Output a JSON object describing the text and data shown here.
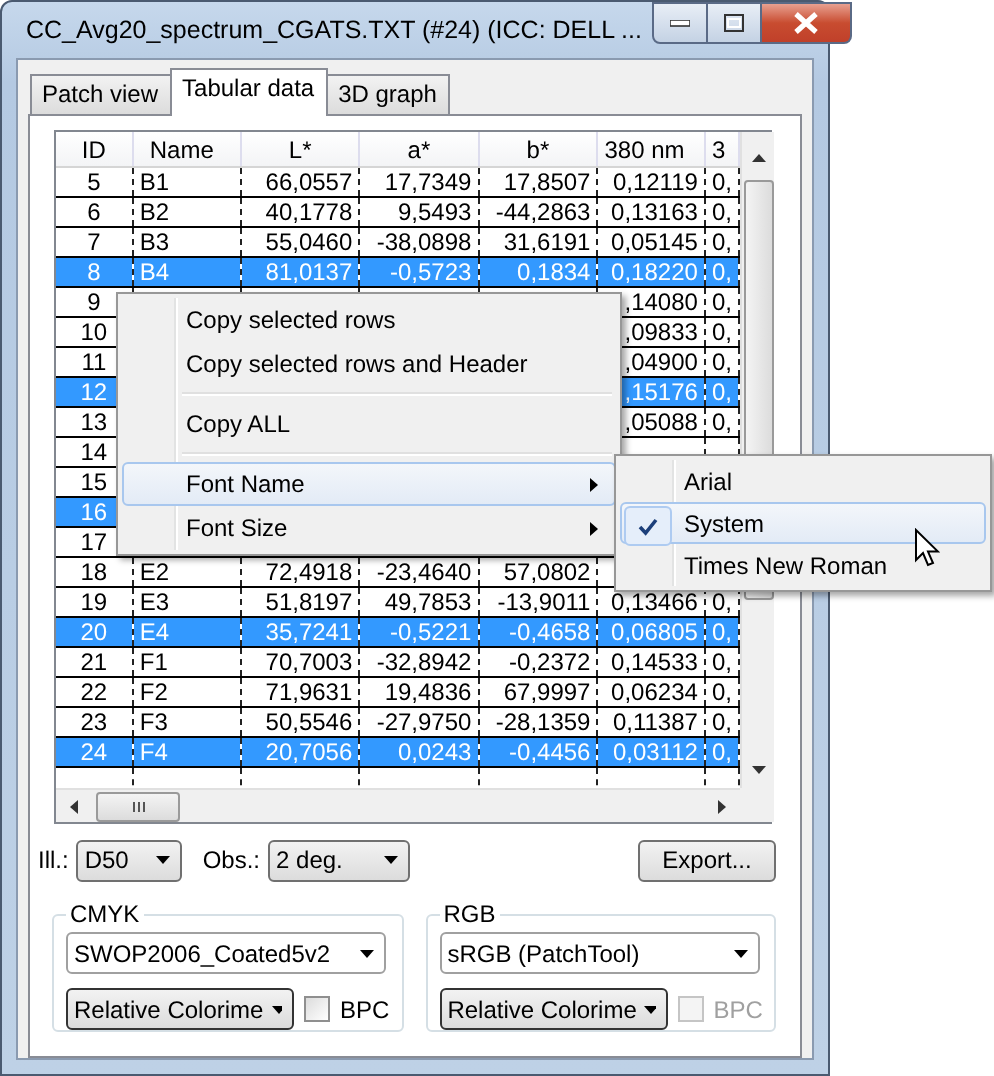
{
  "window": {
    "title": "CC_Avg20_spectrum_CGATS.TXT (#24) (ICC: DELL ..."
  },
  "tabs": [
    {
      "label": "Patch view",
      "selected": false
    },
    {
      "label": "Tabular data",
      "selected": true
    },
    {
      "label": "3D graph",
      "selected": false
    }
  ],
  "table": {
    "columns": [
      "ID",
      "Name",
      "L*",
      "a*",
      "b*",
      "380 nm",
      "3"
    ],
    "rows": [
      {
        "cells": [
          "5",
          "B1",
          "66,0557",
          "17,7349",
          "17,8507",
          "0,12119",
          "0,"
        ],
        "selected": false
      },
      {
        "cells": [
          "6",
          "B2",
          "40,1778",
          "9,5493",
          "-44,2863",
          "0,13163",
          "0,"
        ],
        "selected": false
      },
      {
        "cells": [
          "7",
          "B3",
          "55,0460",
          "-38,0898",
          "31,6191",
          "0,05145",
          "0,"
        ],
        "selected": false
      },
      {
        "cells": [
          "8",
          "B4",
          "81,0137",
          "-0,5723",
          "0,1834",
          "0,18220",
          "0,"
        ],
        "selected": true
      },
      {
        "cells": [
          "9",
          "",
          "",
          "",
          "",
          ",14080",
          "0,"
        ],
        "selected": false
      },
      {
        "cells": [
          "10",
          "",
          "",
          "",
          "",
          ",09833",
          "0,"
        ],
        "selected": false
      },
      {
        "cells": [
          "11",
          "",
          "",
          "",
          "",
          ",04900",
          "0,"
        ],
        "selected": false
      },
      {
        "cells": [
          "12",
          "",
          "",
          "",
          "",
          ",15176",
          "0,"
        ],
        "selected": true
      },
      {
        "cells": [
          "13",
          "",
          "",
          "",
          "",
          ",05088",
          "0,"
        ],
        "selected": false
      },
      {
        "cells": [
          "14",
          "",
          "",
          "",
          "",
          "",
          ""
        ],
        "selected": false
      },
      {
        "cells": [
          "15",
          "",
          "",
          "",
          "",
          "",
          ""
        ],
        "selected": false
      },
      {
        "cells": [
          "16",
          "",
          "",
          "",
          "",
          "",
          ""
        ],
        "selected": true
      },
      {
        "cells": [
          "17",
          "",
          "",
          "",
          "",
          "",
          ""
        ],
        "selected": false
      },
      {
        "cells": [
          "18",
          "E2",
          "72,4918",
          "-23,4640",
          "57,0802",
          "",
          ""
        ],
        "selected": false
      },
      {
        "cells": [
          "19",
          "E3",
          "51,8197",
          "49,7853",
          "-13,9011",
          "0,13466",
          "0,"
        ],
        "selected": false
      },
      {
        "cells": [
          "20",
          "E4",
          "35,7241",
          "-0,5221",
          "-0,4658",
          "0,06805",
          "0,"
        ],
        "selected": true
      },
      {
        "cells": [
          "21",
          "F1",
          "70,7003",
          "-32,8942",
          "-0,2372",
          "0,14533",
          "0,"
        ],
        "selected": false
      },
      {
        "cells": [
          "22",
          "F2",
          "71,9631",
          "19,4836",
          "67,9997",
          "0,06234",
          "0,"
        ],
        "selected": false
      },
      {
        "cells": [
          "23",
          "F3",
          "50,5546",
          "-27,9750",
          "-28,1359",
          "0,11387",
          "0,"
        ],
        "selected": false
      },
      {
        "cells": [
          "24",
          "F4",
          "20,7056",
          "0,0243",
          "-0,4456",
          "0,03112",
          "0,"
        ],
        "selected": true
      }
    ]
  },
  "options": {
    "illuminant_label": "Ill.:",
    "illuminant": "D50",
    "observer_label": "Obs.:",
    "observer": "2 deg.",
    "export_button": "Export..."
  },
  "groups": [
    {
      "title": "CMYK",
      "profile": "SWOP2006_Coated5v2",
      "intent": "Relative Colorime",
      "bpc": {
        "label": "BPC",
        "checked": false,
        "disabled": false
      }
    },
    {
      "title": "RGB",
      "profile": "sRGB (PatchTool)",
      "intent": "Relative Colorime",
      "bpc": {
        "label": "BPC",
        "checked": false,
        "disabled": true
      }
    }
  ],
  "context_menu": {
    "items": [
      {
        "kind": "item",
        "label": "Copy selected rows",
        "selected": false
      },
      {
        "kind": "item",
        "label": "Copy selected rows and Header",
        "selected": false
      },
      {
        "kind": "separator"
      },
      {
        "kind": "item",
        "label": "Copy ALL",
        "selected": false
      },
      {
        "kind": "separator"
      },
      {
        "kind": "submenu",
        "label": "Font Name",
        "selected": true
      },
      {
        "kind": "submenu",
        "label": "Font Size",
        "selected": false
      }
    ]
  },
  "font_submenu": {
    "items": [
      {
        "label": "Arial",
        "checked": false,
        "selected": false
      },
      {
        "label": "System",
        "checked": true,
        "selected": true
      },
      {
        "label": "Times New Roman",
        "checked": false,
        "selected": false
      }
    ]
  }
}
